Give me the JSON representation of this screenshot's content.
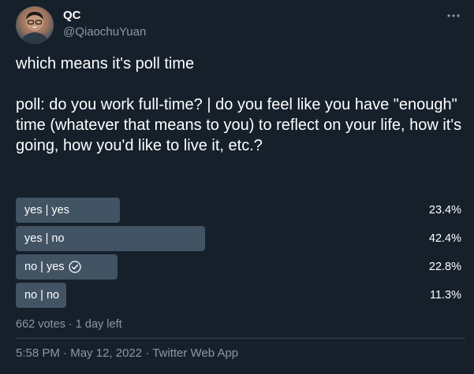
{
  "author": {
    "display_name": "QC",
    "handle": "@QiaochuYuan"
  },
  "more_icon": "more-horizontal-icon",
  "tweet": {
    "text": "which means it's poll time\n\npoll: do you work full-time? | do you feel like you have \"enough\" time (whatever that means to you) to reflect on your life, how it's going, how you'd like to live it, etc.?"
  },
  "poll": {
    "options": [
      {
        "label": "yes | yes",
        "percent_text": "23.4%",
        "fraction": 0.234,
        "selected": false
      },
      {
        "label": "yes | no",
        "percent_text": "42.4%",
        "fraction": 0.424,
        "selected": false
      },
      {
        "label": "no | yes",
        "percent_text": "22.8%",
        "fraction": 0.228,
        "selected": true,
        "icon": "check-circle-icon"
      },
      {
        "label": "no | no",
        "percent_text": "11.3%",
        "fraction": 0.113,
        "selected": false
      }
    ],
    "votes": "662 votes",
    "separator": "·",
    "time_left": "1 day left"
  },
  "footer": {
    "time": "5:58 PM",
    "date": "May 12, 2022",
    "source": "Twitter Web App",
    "separator": "·"
  },
  "colors": {
    "background": "#15202b",
    "bar": "#425364",
    "secondary_text": "#8b98a5",
    "divider": "#38444d"
  }
}
